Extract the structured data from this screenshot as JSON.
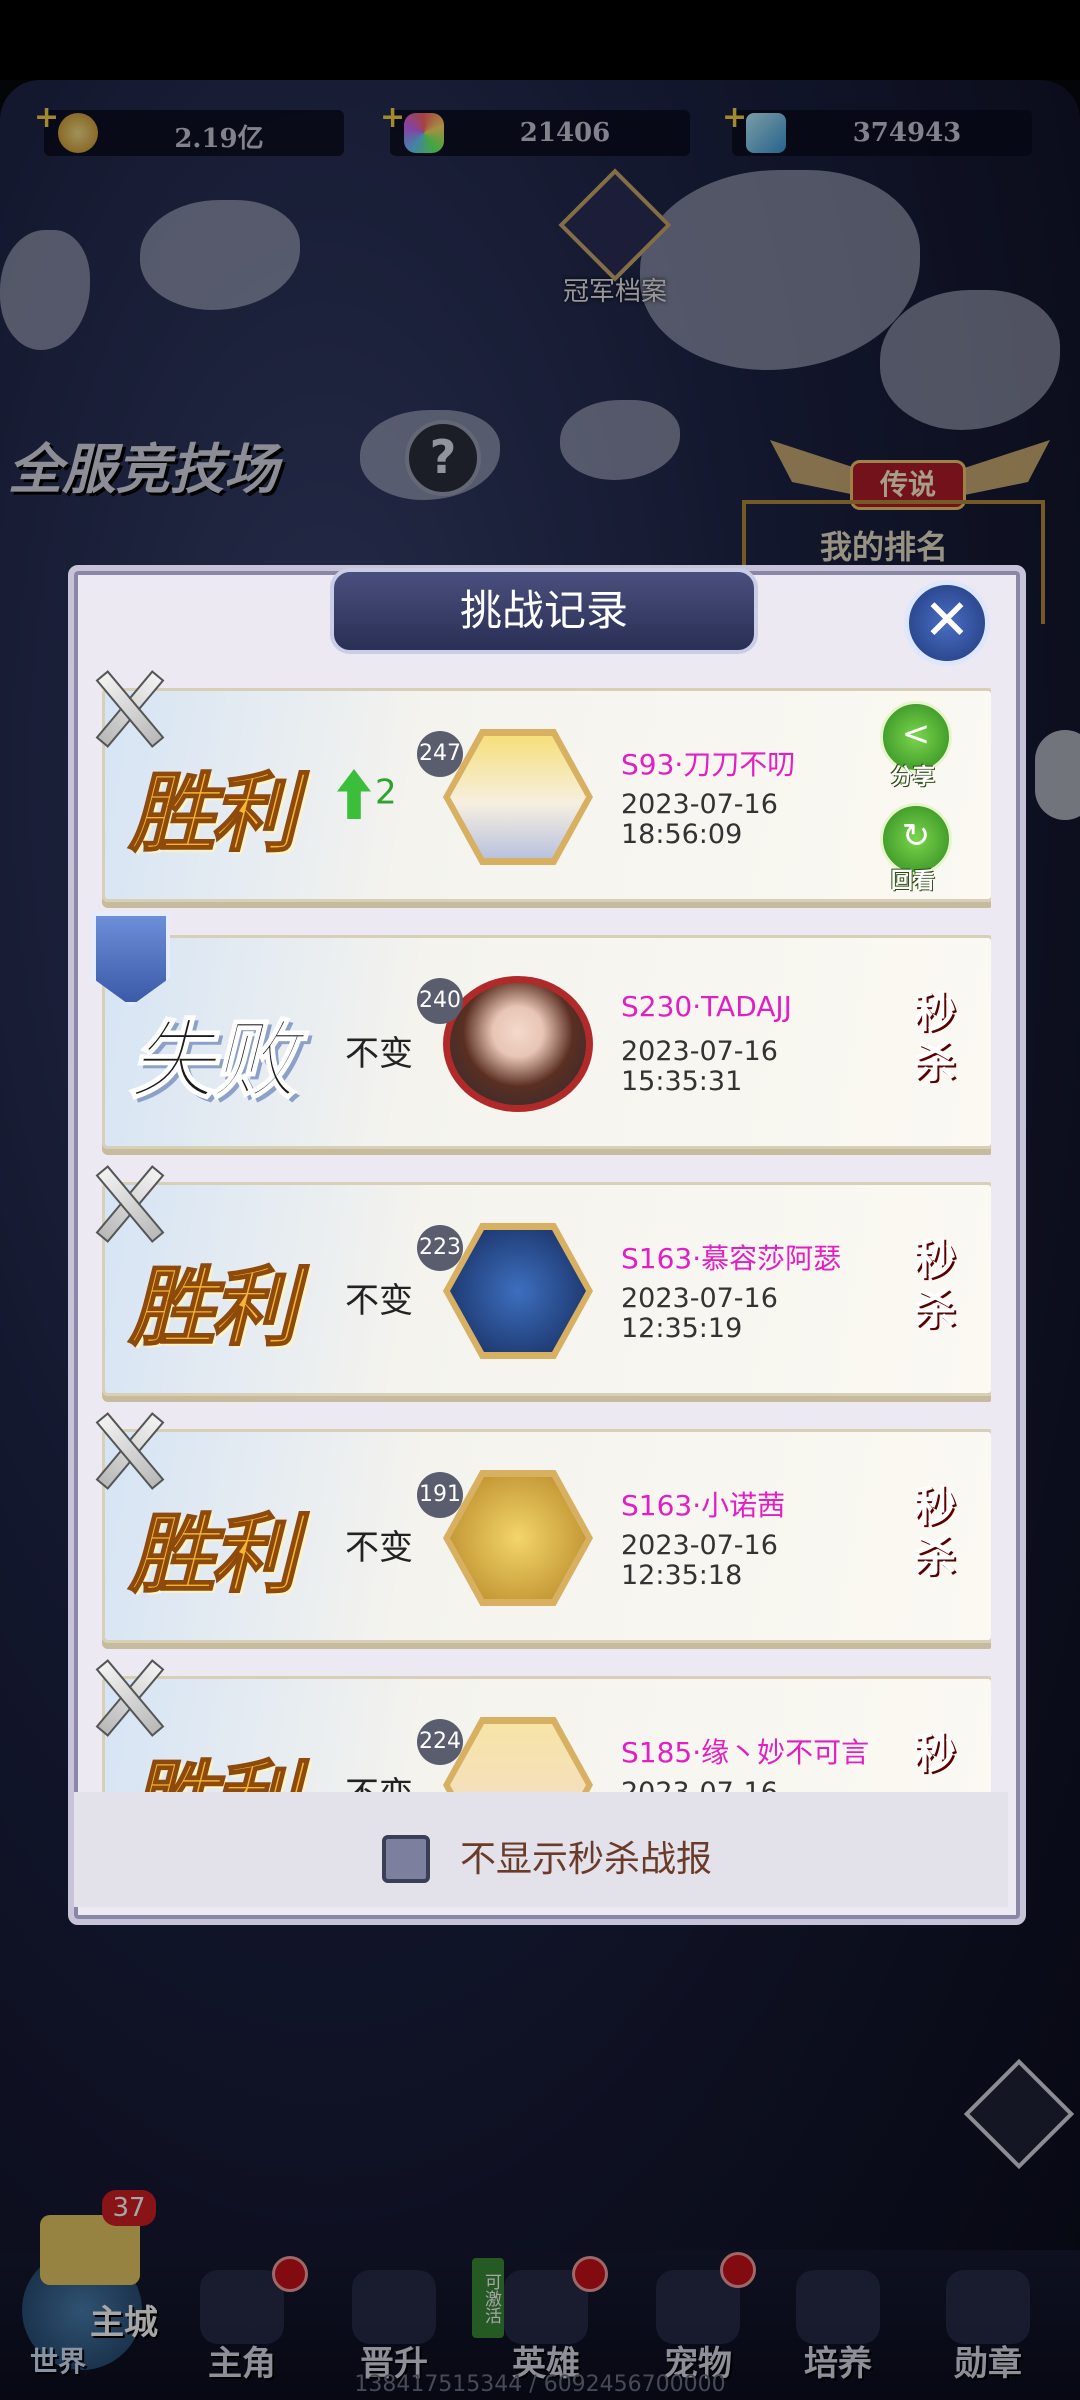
{
  "resources": [
    {
      "icon": "gold-coin-icon",
      "value": "2.19亿"
    },
    {
      "icon": "rainbow-gem-icon",
      "value": "21406"
    },
    {
      "icon": "blue-diamond-icon",
      "value": "374943"
    }
  ],
  "header": {
    "champion_archive_label": "冠军档案",
    "arena_title": "全服竞技场",
    "help_label": "?",
    "legend_label": "传说",
    "my_rank_label": "我的排名"
  },
  "modal": {
    "title": "挑战记录",
    "close_label": "✕",
    "records": [
      {
        "result": "胜利",
        "result_type": "win",
        "change": "2",
        "change_up": true,
        "level": "247",
        "player": "S93·刀刀不叨",
        "date": "2023-07-16",
        "time": "18:56:09",
        "share_label": "分享",
        "replay_label": "回看"
      },
      {
        "result": "失败",
        "result_type": "lose",
        "change": "不变",
        "level": "240",
        "player": "S230·TADAJJ",
        "date": "2023-07-16",
        "time": "15:35:31",
        "seckill_label": "秒杀"
      },
      {
        "result": "胜利",
        "result_type": "win",
        "change": "不变",
        "level": "223",
        "player": "S163·慕容莎阿瑟",
        "date": "2023-07-16",
        "time": "12:35:19",
        "seckill_label": "秒杀"
      },
      {
        "result": "胜利",
        "result_type": "win",
        "change": "不变",
        "level": "191",
        "player": "S163·小诺茜",
        "date": "2023-07-16",
        "time": "12:35:18",
        "seckill_label": "秒杀"
      },
      {
        "result": "胜利",
        "result_type": "win",
        "change": "不变",
        "level": "224",
        "player": "S185·缘丶妙不可言",
        "date": "2023-07-16",
        "time": "",
        "seckill_label": "秒"
      }
    ],
    "hide_seckill_label": "不显示秒杀战报",
    "hide_seckill_checked": false
  },
  "world_button": {
    "badge": "37",
    "main_label": "主城",
    "world_label": "世界"
  },
  "bottom_nav": [
    {
      "label": "主角",
      "icon": "hero-head-icon",
      "red_dot": true
    },
    {
      "label": "晋升",
      "icon": "promotion-wings-icon",
      "red_dot": false
    },
    {
      "label": "英雄",
      "icon": "helmet-icon",
      "red_dot": true,
      "tag": "可激活"
    },
    {
      "label": "宠物",
      "icon": "pet-icon",
      "red_dot": true
    },
    {
      "label": "培养",
      "icon": "train-icon",
      "red_dot": false
    },
    {
      "label": "勋章",
      "icon": "medal-icon",
      "red_dot": false
    }
  ],
  "footer_id": "138417515344 / 6092456700000",
  "colors": {
    "win": "#f7b531",
    "player_name": "#e21fc5",
    "seckill": "#a3121a",
    "modal_bg": "#ece9f2"
  }
}
